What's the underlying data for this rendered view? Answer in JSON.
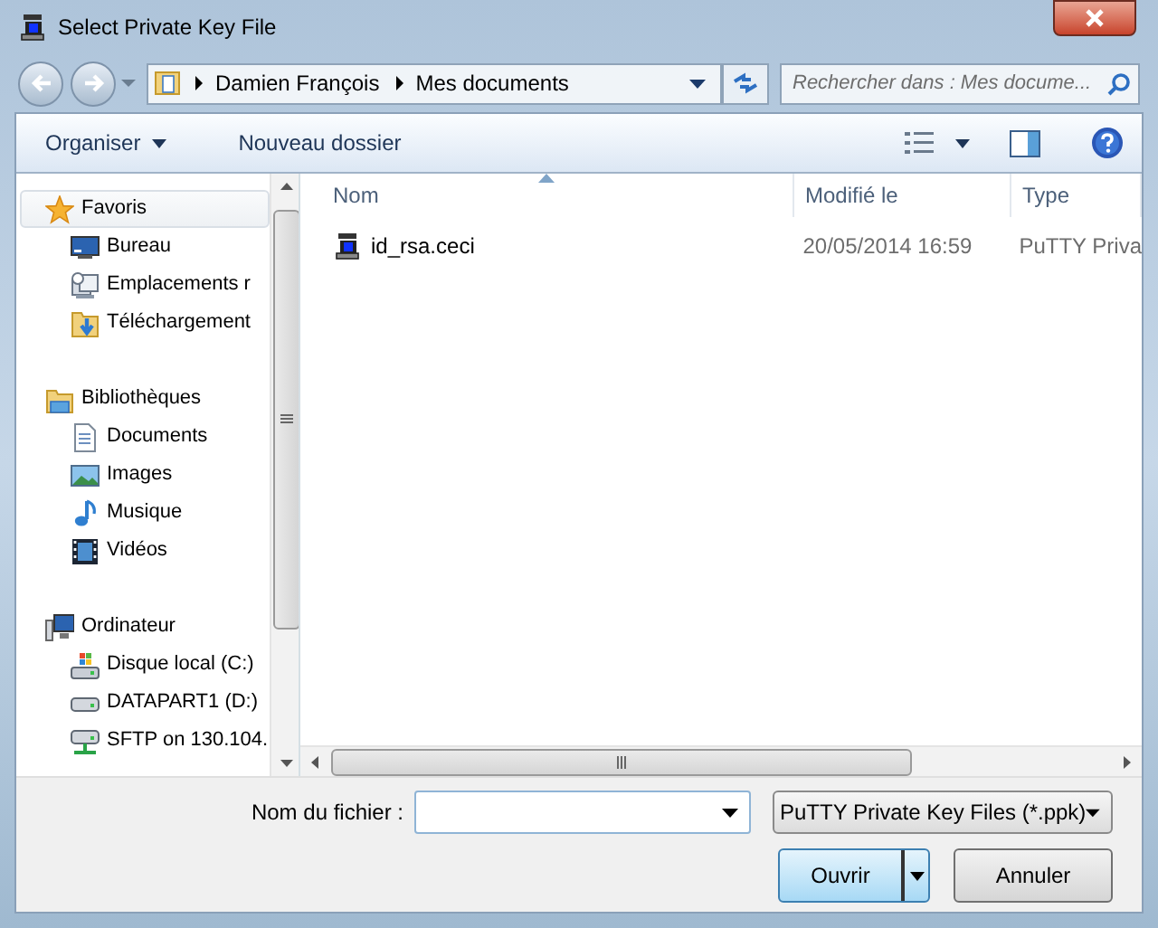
{
  "window": {
    "title": "Select Private Key File"
  },
  "address": {
    "path": [
      "Damien François",
      "Mes documents"
    ]
  },
  "search": {
    "placeholder": "Rechercher dans : Mes docume..."
  },
  "toolbar": {
    "buttons": [
      {
        "label": "Organiser",
        "dropdown": true
      },
      {
        "label": "Nouveau dossier",
        "dropdown": false
      }
    ]
  },
  "sidebar": {
    "groups": [
      {
        "label": "Favoris",
        "kind": "star",
        "selected": true,
        "children": [
          {
            "label": "Bureau",
            "kind": "desktop",
            "selected": false
          },
          {
            "label": "Emplacements r",
            "kind": "recent",
            "selected": false
          },
          {
            "label": "Téléchargement",
            "kind": "download",
            "selected": false
          }
        ]
      },
      {
        "label": "Bibliothèques",
        "kind": "library",
        "selected": false,
        "children": [
          {
            "label": "Documents",
            "kind": "document",
            "selected": false
          },
          {
            "label": "Images",
            "kind": "image",
            "selected": false
          },
          {
            "label": "Musique",
            "kind": "music",
            "selected": false
          },
          {
            "label": "Vidéos",
            "kind": "video",
            "selected": false
          }
        ]
      },
      {
        "label": "Ordinateur",
        "kind": "computer",
        "selected": false,
        "children": [
          {
            "label": "Disque local (C:)",
            "kind": "system_drive",
            "selected": false
          },
          {
            "label": "DATAPART1 (D:)",
            "kind": "drive",
            "selected": false
          },
          {
            "label": "SFTP on 130.104.",
            "kind": "network_drive",
            "selected": false
          }
        ]
      }
    ]
  },
  "file_list": {
    "columns": [
      {
        "label": "Nom",
        "sorted": true
      },
      {
        "label": "Modifié le",
        "sorted": false
      },
      {
        "label": "Type",
        "sorted": false
      }
    ],
    "rows": [
      {
        "cells": [
          "id_rsa.ceci",
          "20/05/2014 16:59",
          "PuTTY Priva"
        ],
        "selected": false
      }
    ]
  },
  "filename": {
    "label": "Nom du fichier :"
  },
  "file_type": {
    "value": "PuTTY Private Key Files (*.ppk)"
  },
  "buttons": [
    {
      "label": "Ouvrir",
      "kind": "split",
      "default": true
    },
    {
      "label": "Annuler",
      "kind": "plain",
      "default": false
    }
  ]
}
